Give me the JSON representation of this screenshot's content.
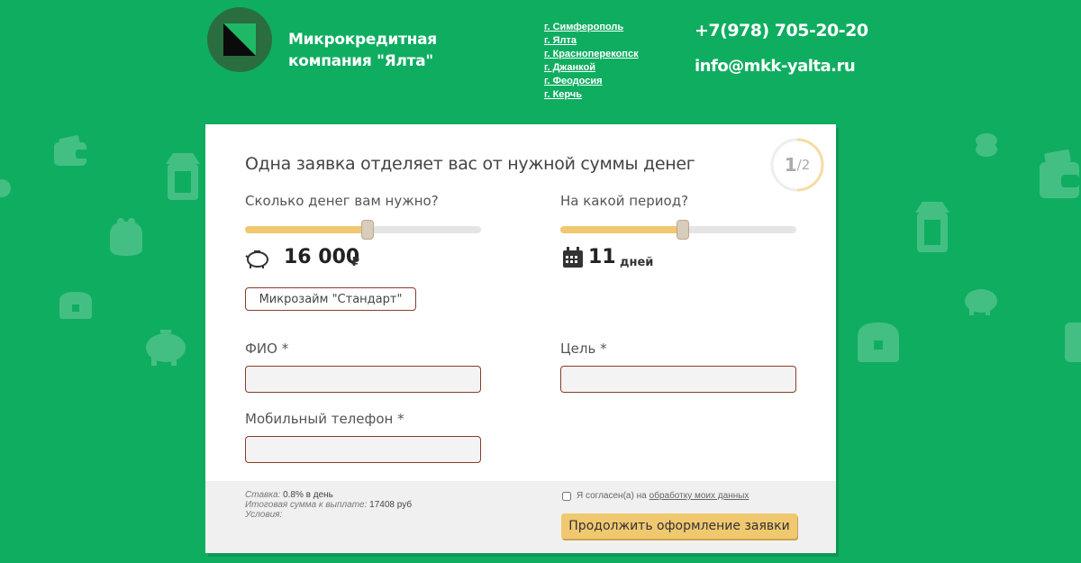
{
  "header": {
    "company_name": "Микрокредитная компания \"Ялта\"",
    "cities": [
      "г. Симферополь",
      "г. Ялта",
      "г. Красноперекопск",
      "г. Джанкой",
      "г. Феодосия",
      "г. Керчь"
    ],
    "phone": "+7(978) 705-20-20",
    "email": "info@mkk-yalta.ru"
  },
  "form": {
    "title": "Одна заявка отделяет вас от нужной суммы денег",
    "step_current": "1",
    "step_total": "/2",
    "amount_label": "Сколько денег вам нужно?",
    "amount_value": "16 000",
    "amount_currency": "₽",
    "amount_slider_fraction": 0.52,
    "period_label": "На какой период?",
    "period_value": "11",
    "period_unit": "дней",
    "period_slider_fraction": 0.52,
    "product_button": "Микрозайм \"Стандарт\"",
    "fio_label": "ФИО *",
    "goal_label": "Цель *",
    "phone_label": "Мобильный телефон *",
    "fio_value": "",
    "goal_value": "",
    "phone_value": ""
  },
  "footer": {
    "rate_label": "Ставка:",
    "rate_value": "0.8% в день",
    "total_label": "Итоговая сумма к выплате:",
    "total_value": "17408 руб",
    "conditions_label": "Условия:",
    "agree_text": "Я согласен(а) на",
    "agree_link": "обработку моих данных",
    "agree_checked": false,
    "submit_label": "Продолжить оформление заявки"
  },
  "colors": {
    "background": "#0fad60",
    "accent": "#f0c870",
    "field_border": "#8a3c2a"
  }
}
